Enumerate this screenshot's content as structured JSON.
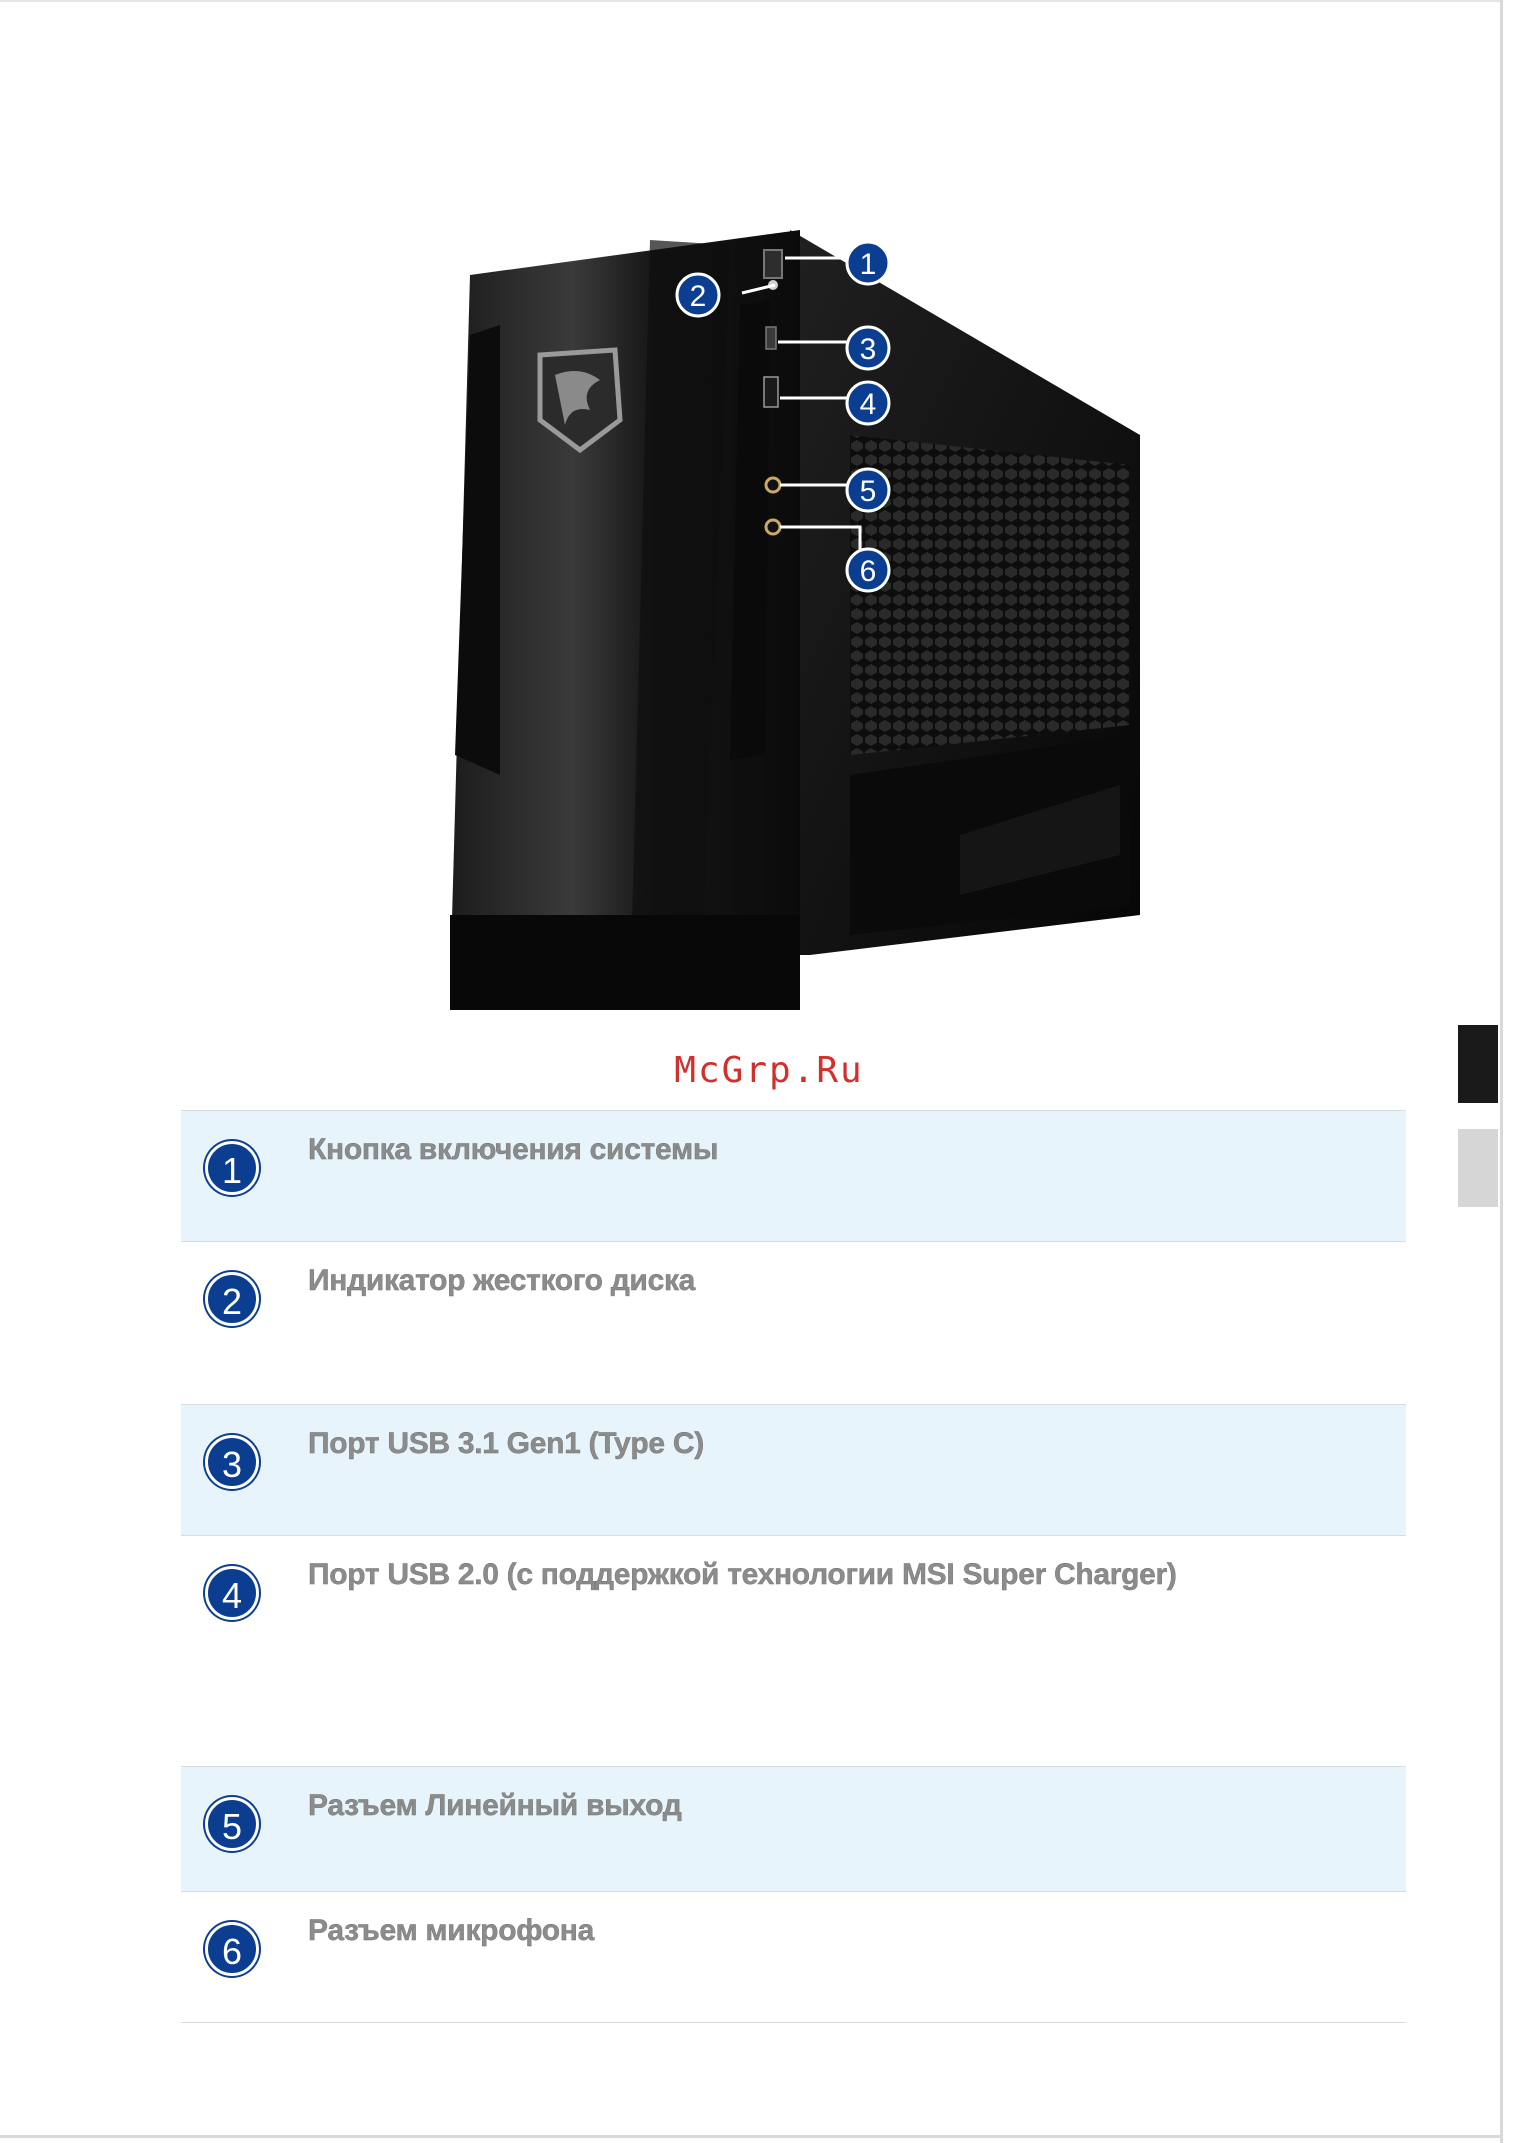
{
  "watermark": "McGrp.Ru",
  "figure": {
    "callouts": [
      "1",
      "2",
      "3",
      "4",
      "5",
      "6"
    ]
  },
  "items": [
    {
      "number": "1",
      "label": "Кнопка включения системы"
    },
    {
      "number": "2",
      "label": "Индикатор жесткого диска"
    },
    {
      "number": "3",
      "label": "Порт USB 3.1 Gen1 (Type C)"
    },
    {
      "number": "4",
      "label": "Порт USB 2.0 (с поддержкой технологии MSI Super Charger)"
    },
    {
      "number": "5",
      "label": "Разъем Линейный выход"
    },
    {
      "number": "6",
      "label": "Разъем микрофона"
    }
  ],
  "colors": {
    "accent": "#0b3d91",
    "row_shade": "#e8f4fb",
    "watermark": "#d0312d"
  }
}
